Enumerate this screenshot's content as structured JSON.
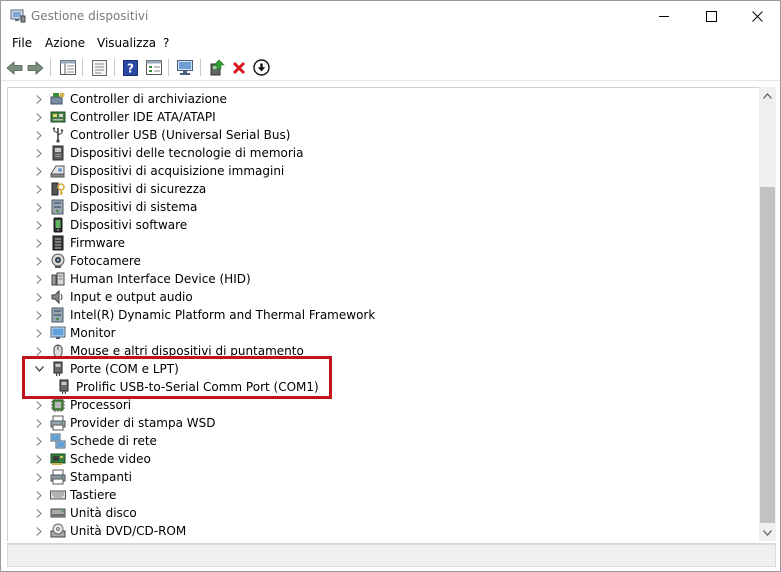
{
  "window": {
    "title": "Gestione dispositivi"
  },
  "menu": [
    "File",
    "Azione",
    "Visualizza",
    "?"
  ],
  "tree": [
    {
      "label": "Controller di archiviazione",
      "icon": "storage-controller-icon",
      "state": "collapsed"
    },
    {
      "label": "Controller IDE ATA/ATAPI",
      "icon": "ide-controller-icon",
      "state": "collapsed"
    },
    {
      "label": "Controller USB (Universal Serial Bus)",
      "icon": "usb-icon",
      "state": "collapsed"
    },
    {
      "label": "Dispositivi delle tecnologie di memoria",
      "icon": "memory-tech-icon",
      "state": "collapsed"
    },
    {
      "label": "Dispositivi di acquisizione immagini",
      "icon": "imaging-device-icon",
      "state": "collapsed"
    },
    {
      "label": "Dispositivi di sicurezza",
      "icon": "security-device-icon",
      "state": "collapsed"
    },
    {
      "label": "Dispositivi di sistema",
      "icon": "system-device-icon",
      "state": "collapsed"
    },
    {
      "label": "Dispositivi software",
      "icon": "software-device-icon",
      "state": "collapsed"
    },
    {
      "label": "Firmware",
      "icon": "firmware-icon",
      "state": "collapsed"
    },
    {
      "label": "Fotocamere",
      "icon": "camera-icon",
      "state": "collapsed"
    },
    {
      "label": "Human Interface Device (HID)",
      "icon": "hid-icon",
      "state": "collapsed"
    },
    {
      "label": "Input e output audio",
      "icon": "audio-icon",
      "state": "collapsed"
    },
    {
      "label": "Intel(R) Dynamic Platform and Thermal Framework",
      "icon": "thermal-framework-icon",
      "state": "collapsed"
    },
    {
      "label": "Monitor",
      "icon": "monitor-icon",
      "state": "collapsed"
    },
    {
      "label": "Mouse e altri dispositivi di puntamento",
      "icon": "mouse-icon",
      "state": "collapsed"
    },
    {
      "label": "Porte (COM e LPT)",
      "icon": "port-icon",
      "state": "expanded"
    },
    {
      "label": "Prolific USB-to-Serial Comm Port (COM1)",
      "icon": "serial-port-icon",
      "state": "child"
    },
    {
      "label": "Processori",
      "icon": "processor-icon",
      "state": "collapsed"
    },
    {
      "label": "Provider di stampa WSD",
      "icon": "wsd-print-icon",
      "state": "collapsed"
    },
    {
      "label": "Schede di rete",
      "icon": "network-adapter-icon",
      "state": "collapsed"
    },
    {
      "label": "Schede video",
      "icon": "display-adapter-icon",
      "state": "collapsed"
    },
    {
      "label": "Stampanti",
      "icon": "printer-icon",
      "state": "collapsed"
    },
    {
      "label": "Tastiere",
      "icon": "keyboard-icon",
      "state": "collapsed"
    },
    {
      "label": "Unità disco",
      "icon": "disk-drive-icon",
      "state": "collapsed"
    },
    {
      "label": "Unità DVD/CD-ROM",
      "icon": "dvd-drive-icon",
      "state": "collapsed"
    }
  ],
  "colors": {
    "highlight": "#c0141c",
    "scroll_thumb": "#c2c2c2"
  }
}
